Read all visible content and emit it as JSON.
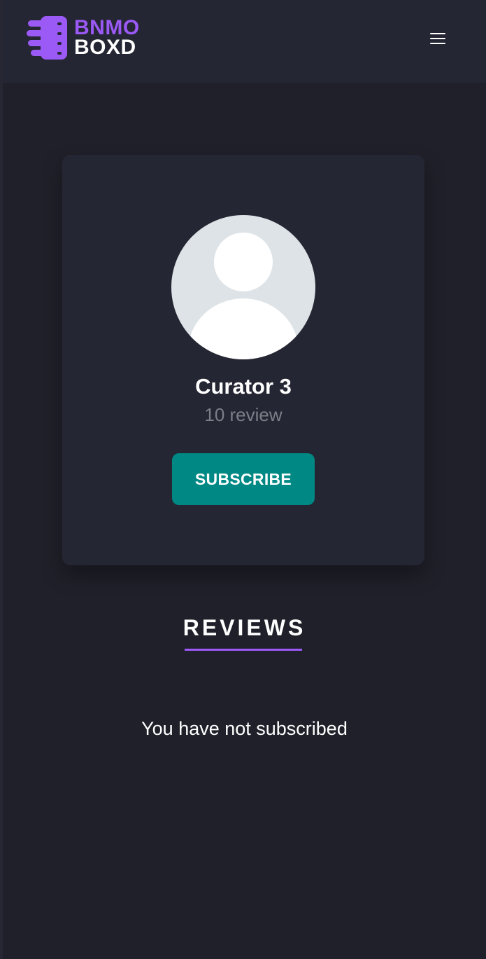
{
  "header": {
    "logo_top": "BNMO",
    "logo_bottom": "BOXD",
    "menu_icon": "hamburger-icon"
  },
  "profile": {
    "name": "Curator 3",
    "review_count": "10 review",
    "avatar_icon": "default-user-avatar",
    "subscribe_label": "SUBSCRIBE"
  },
  "reviews": {
    "title": "REVIEWS",
    "empty_message": "You have not subscribed"
  },
  "colors": {
    "background": "#20202a",
    "header": "#242633",
    "card": "#252633",
    "accent_purple": "#9b59f6",
    "button_teal": "#008884",
    "muted_text": "#7c7e88"
  }
}
